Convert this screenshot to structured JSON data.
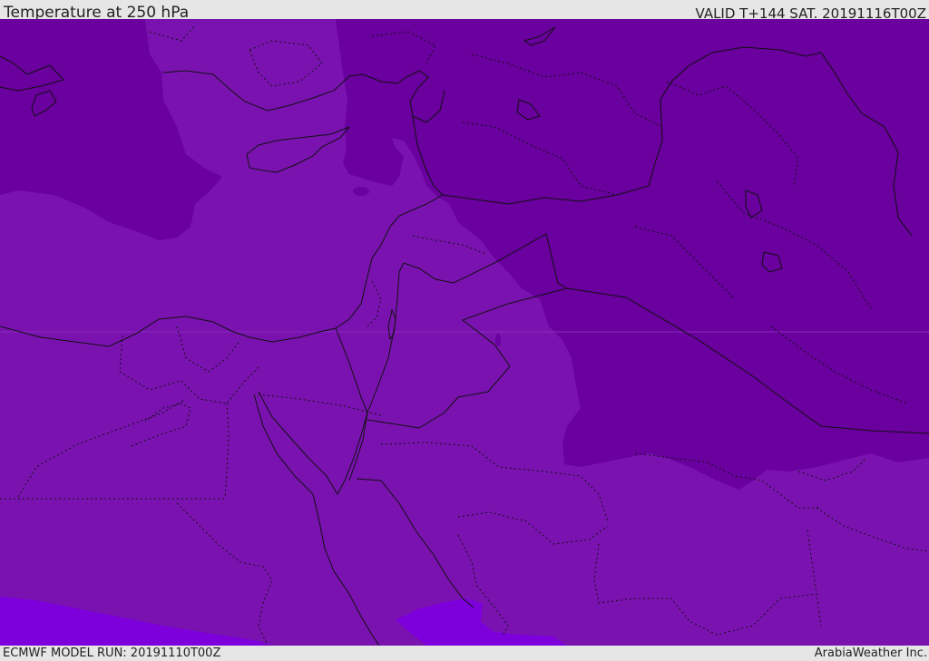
{
  "header": {
    "title": "Temperature at 250 hPa",
    "valid": "VALID T+144 SAT. 20191116T00Z"
  },
  "footer": {
    "model_run": "ECMWF MODEL RUN: 20191110T00Z",
    "credit": "ArabiaWeather Inc."
  },
  "colors": {
    "cold_band": "#6a009e",
    "mid_band": "#7a12b0",
    "warm_band": "#7d00dc",
    "lines": "#111111",
    "background": "#e6e6e6"
  }
}
